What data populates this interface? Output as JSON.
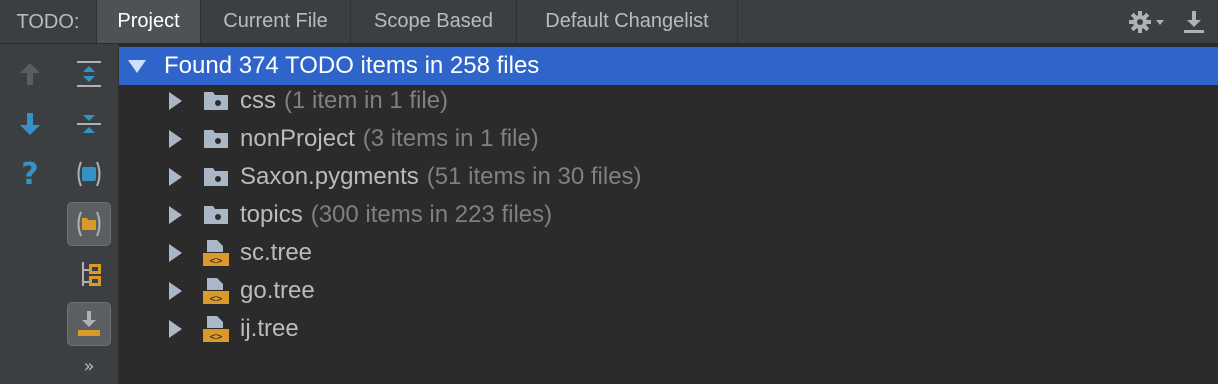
{
  "tabbar": {
    "label": "TODO:",
    "tabs": [
      {
        "label": "Project",
        "active": true
      },
      {
        "label": "Current File",
        "active": false
      },
      {
        "label": "Scope Based",
        "active": false
      },
      {
        "label": "Default Changelist",
        "active": false
      }
    ],
    "icons": [
      "gear-icon",
      "chevron-down-icon",
      "hide-panel-icon"
    ]
  },
  "toolbar_left": {
    "items": [
      "previous-occurrence-icon",
      "next-occurrence-icon",
      "help-icon"
    ]
  },
  "toolbar_right": {
    "items": [
      "expand-all-icon",
      "collapse-all-icon",
      "preview-icon",
      "group-by-module-icon",
      "group-by-package-icon",
      "autoscroll-icon"
    ],
    "more": "»"
  },
  "tree": {
    "root": "Found 374 TODO items in 258 files",
    "items": [
      {
        "name": "css",
        "count": "(1 item in 1 file)",
        "type": "folder"
      },
      {
        "name": "nonProject",
        "count": "(3 items in 1 file)",
        "type": "folder"
      },
      {
        "name": "Saxon.pygments",
        "count": "(51 items in 30 files)",
        "type": "folder"
      },
      {
        "name": "topics",
        "count": "(300 items in 223 files)",
        "type": "folder"
      },
      {
        "name": "sc.tree",
        "count": "",
        "type": "tree-file"
      },
      {
        "name": "go.tree",
        "count": "",
        "type": "tree-file"
      },
      {
        "name": "ij.tree",
        "count": "",
        "type": "tree-file"
      }
    ]
  },
  "colors": {
    "background": "#2b2b2b",
    "panel": "#3c3f41",
    "selection": "#2f65ca",
    "accent_blue": "#3592c4",
    "file_orange": "#d99a2a"
  }
}
